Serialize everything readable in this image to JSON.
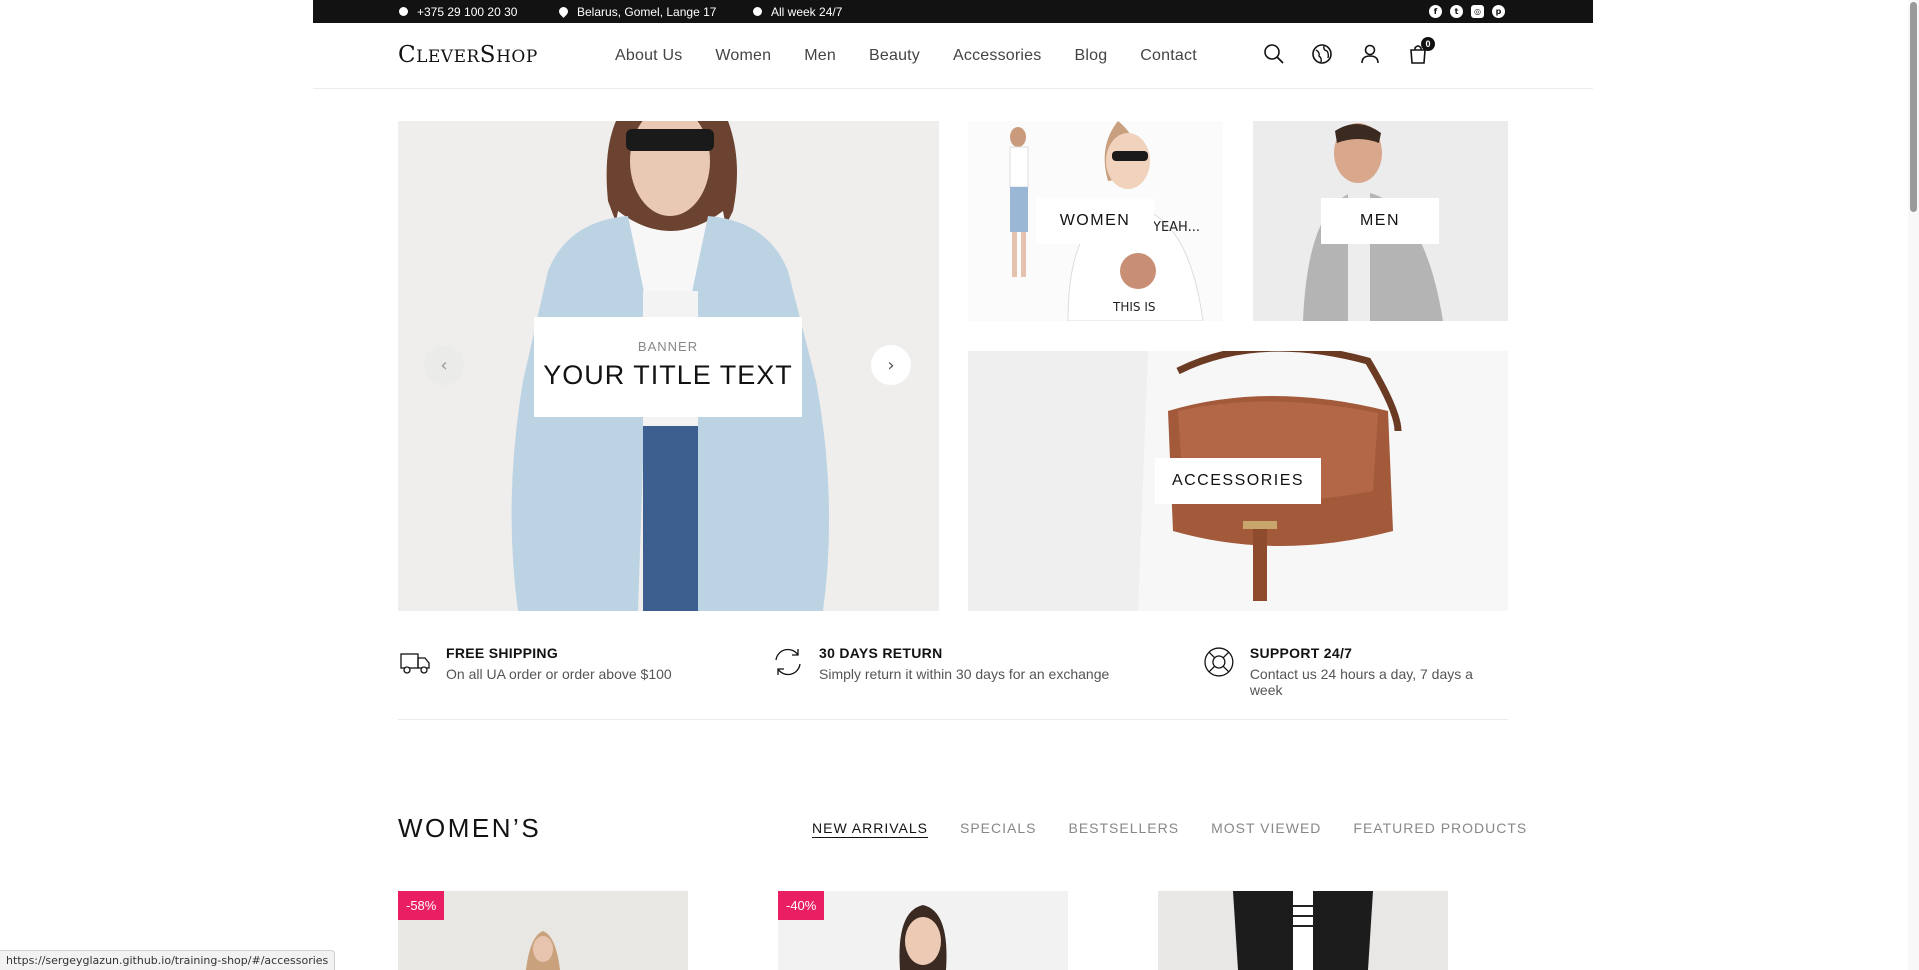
{
  "topbar": {
    "phone": "+375 29 100 20 30",
    "address": "Belarus, Gomel, Lange 17",
    "hours": "All week 24/7",
    "social": [
      "facebook-icon",
      "twitter-icon",
      "instagram-icon",
      "pinterest-icon"
    ]
  },
  "header": {
    "logo": "CleverShop",
    "nav": [
      "About Us",
      "Women",
      "Men",
      "Beauty",
      "Accessories",
      "Blog",
      "Contact"
    ],
    "icons": [
      "search-icon",
      "globe-icon",
      "user-icon",
      "cart-icon"
    ],
    "cart_count": "0"
  },
  "hero": {
    "banner_sub": "BANNER",
    "banner_title": "YOUR TITLE TEXT",
    "women_label": "WOMEN",
    "men_label": "MEN",
    "accessories_label": "ACCESSORIES"
  },
  "features": [
    {
      "title": "FREE SHIPPING",
      "desc": "On all UA order or order above $100",
      "icon": "truck-icon"
    },
    {
      "title": "30 DAYS RETURN",
      "desc": "Simply return it within 30 days for an exchange",
      "icon": "return-icon"
    },
    {
      "title": "SUPPORT 24/7",
      "desc": "Contact us 24 hours a day, 7 days a week",
      "icon": "lifebuoy-icon"
    }
  ],
  "section": {
    "title": "WOMEN’S",
    "tabs": [
      "NEW ARRIVALS",
      "SPECIALS",
      "BESTSELLERS",
      "MOST VIEWED",
      "FEATURED PRODUCTS"
    ],
    "active_tab": "NEW ARRIVALS"
  },
  "products": [
    {
      "discount": "-58%"
    },
    {
      "discount": "-40%"
    },
    {
      "discount": ""
    }
  ],
  "statusbar": {
    "url": "https://sergeyglazun.github.io/training-shop/#/accessories"
  },
  "colors": {
    "topbar_bg": "#121212",
    "discount_badge": "#e91e63",
    "text_primary": "#121212"
  }
}
